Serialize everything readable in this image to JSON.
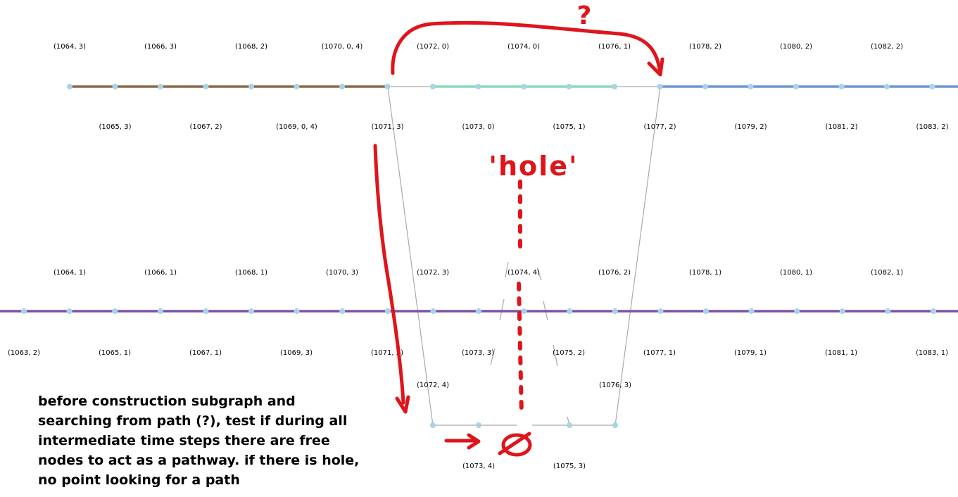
{
  "colors": {
    "brown": "#8B6A4A",
    "green": "#8FD8BA",
    "blue": "#6F96D1",
    "purple": "#7B52A8",
    "grey": "#AAAAAA",
    "node": "#A9D4E4",
    "red": "#E0141B"
  },
  "top_row": {
    "labels_above": [
      "(1064, 3)",
      "(1066, 3)",
      "(1068, 2)",
      "(1070, 0, 4)",
      "(1072, 0)",
      "(1074, 0)",
      "(1076, 1)",
      "(1078, 2)",
      "(1080, 2)",
      "(1082, 2)"
    ],
    "labels_below": [
      "(1065, 3)",
      "(1067, 2)",
      "(1069, 0, 4)",
      "(1071, 3)",
      "(1073, 0)",
      "(1075, 1)",
      "(1077, 2)",
      "(1079, 2)",
      "(1081, 2)",
      "(1083, 2)"
    ]
  },
  "middle_row": {
    "labels_above": [
      "(1064, 1)",
      "(1066, 1)",
      "(1068, 1)",
      "(1070, 3)",
      "(1072, 3)",
      "(1074, 4)",
      "(1076, 2)",
      "(1078, 1)",
      "(1080, 1)",
      "(1082, 1)"
    ],
    "labels_below": [
      "(1063, 2)",
      "(1065, 1)",
      "(1067, 1)",
      "(1069, 3)",
      "(1071, 2)",
      "(1073, 3)",
      "(1075, 2)",
      "(1077, 1)",
      "(1079, 1)",
      "(1081, 1)",
      "(1083, 1)"
    ]
  },
  "bottom_row": {
    "labels_above": [
      "(1072, 4)",
      "(1076, 3)"
    ],
    "labels_below": [
      "(1073, 4)",
      "(1075, 3)"
    ]
  },
  "annotations": {
    "question_mark": "?",
    "hole_label": "'hole'",
    "note": "before construction subgraph and searching from path (?), test if during all intermediate time steps there are free nodes to act as a pathway. if there is hole, no point looking for a path"
  }
}
